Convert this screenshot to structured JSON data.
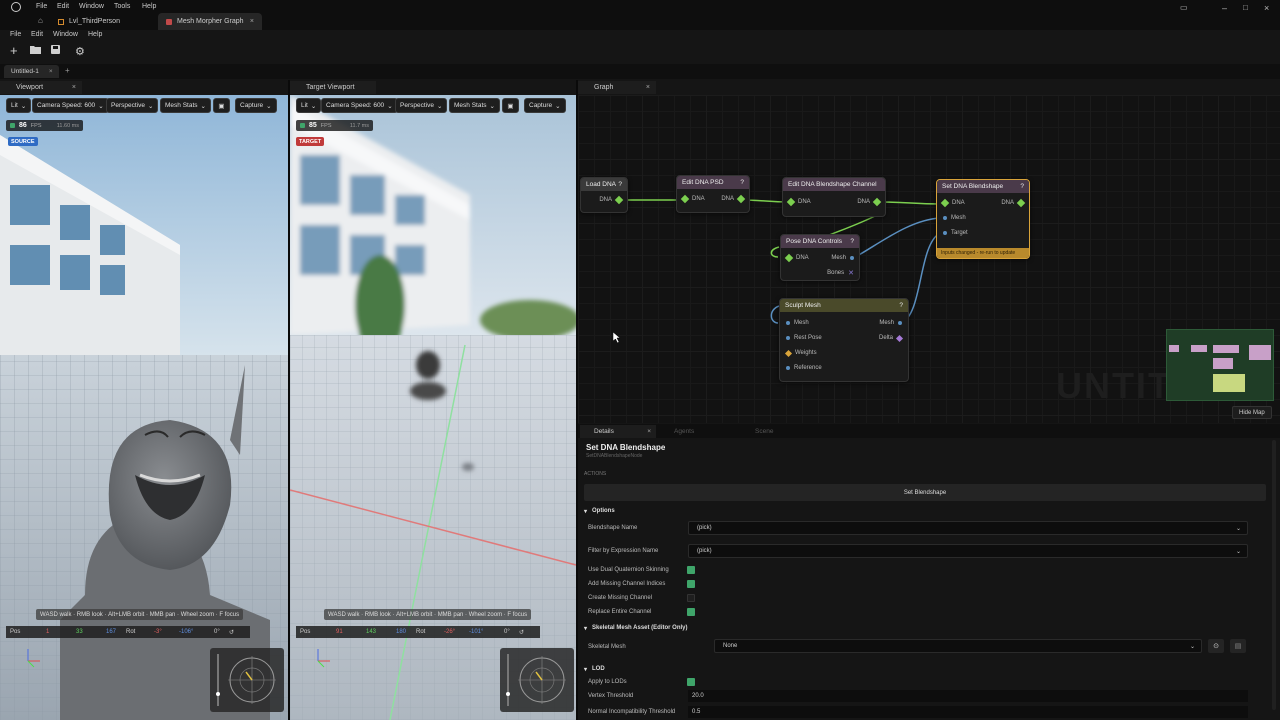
{
  "titlebar": {
    "menus": [
      "File",
      "Edit",
      "Window",
      "Tools",
      "Help"
    ],
    "tabs": [
      "Lvl_ThirdPerson",
      "Mesh Morpher Graph"
    ]
  },
  "menubar": {
    "items": [
      "File",
      "Edit",
      "Window",
      "Help"
    ]
  },
  "toolbar": {
    "icons": [
      "add-icon",
      "open-folder-icon",
      "save-icon",
      "settings-gear-icon"
    ]
  },
  "workspace_tab": {
    "label": "Untitled-1",
    "close": "×",
    "add": "+"
  },
  "viewports": [
    {
      "tab": "Viewport",
      "buttons": {
        "lit": "Lit",
        "camera_speed": "Camera Speed: 600",
        "perspective": "Perspective",
        "mesh_stats": "Mesh Stats",
        "capture": "Capture"
      },
      "fps_value": "86",
      "fps_unit": "FPS",
      "ms": "11.60 ms",
      "badge": "SOURCE",
      "hints": [
        "WASD walk",
        "RMB look",
        "Alt+LMB orbit",
        "MMB pan",
        "Wheel zoom",
        "F focus"
      ],
      "pos": {
        "label": "Pos",
        "x": "1",
        "y": "33",
        "z": "167",
        "rot_label": "Rot",
        "rx": "-3°",
        "ry": "-106°",
        "rz": "0°"
      }
    },
    {
      "tab": "Target Viewport",
      "buttons": {
        "lit": "Lit",
        "camera_speed": "Camera Speed: 600",
        "perspective": "Perspective",
        "mesh_stats": "Mesh Stats",
        "capture": "Capture"
      },
      "fps_value": "85",
      "fps_unit": "FPS",
      "ms": "11.7 ms",
      "badge": "TARGET",
      "hints": [
        "WASD walk",
        "RMB look",
        "Alt+LMB orbit",
        "MMB pan",
        "Wheel zoom",
        "F focus"
      ],
      "pos": {
        "label": "Pos",
        "x": "91",
        "y": "143",
        "z": "180",
        "rot_label": "Rot",
        "rx": "-26°",
        "ry": "-101°",
        "rz": "0°"
      }
    }
  ],
  "graph": {
    "tab": "Graph",
    "watermark": "UNTIT",
    "hide_map": "Hide Map",
    "nodes": {
      "load_dna": {
        "title": "Load DNA",
        "out": "DNA"
      },
      "edit_dna_psd": {
        "title": "Edit DNA PSD",
        "in": "DNA",
        "out": "DNA"
      },
      "edit_blendshape": {
        "title": "Edit DNA Blendshape Channel",
        "in": "DNA",
        "out": "DNA"
      },
      "set_blendshape": {
        "title": "Set DNA Blendshape",
        "in_dna": "DNA",
        "out_dna": "DNA",
        "mesh": "Mesh",
        "target": "Target",
        "status": "Inputs changed - re-run to update"
      },
      "pose_controls": {
        "title": "Pose DNA Controls",
        "in": "DNA",
        "mesh": "Mesh",
        "bones": "Bones"
      },
      "sculpt_mesh": {
        "title": "Sculpt Mesh",
        "mesh_in": "Mesh",
        "mesh_out": "Mesh",
        "rest_pose": "Rest Pose",
        "delta": "Delta",
        "weights": "Weights",
        "reference": "Reference"
      }
    }
  },
  "details": {
    "tabs": [
      "Details",
      "Agents",
      "Scene"
    ],
    "title": "Set DNA Blendshape",
    "subtitle": "SetDNABlendshapeNode",
    "actions_label": "ACTIONS",
    "action_button": "Set Blendshape",
    "sections": {
      "options": "Options",
      "skeletal": "Skeletal Mesh Asset (Editor Only)",
      "lod": "LOD"
    },
    "props": {
      "blendshape_name": {
        "label": "Blendshape Name",
        "value": "(pick)"
      },
      "filter_expression": {
        "label": "Filter by Expression Name",
        "value": "(pick)"
      },
      "dual_quat": {
        "label": "Use Dual Quaternion Skinning",
        "checked": true
      },
      "add_missing": {
        "label": "Add Missing Channel Indices",
        "checked": true
      },
      "create_missing": {
        "label": "Create Missing Channel",
        "checked": false
      },
      "replace_entire": {
        "label": "Replace Entire Channel",
        "checked": true
      },
      "skeletal_mesh": {
        "label": "Skeletal Mesh",
        "value": "None"
      },
      "apply_lods": {
        "label": "Apply to LODs",
        "checked": true
      },
      "vertex_threshold": {
        "label": "Vertex Threshold",
        "value": "20.0"
      },
      "normal_threshold": {
        "label": "Normal Incompatibility Threshold",
        "value": "0.5"
      }
    }
  },
  "colors": {
    "accent_green": "#3fa56a",
    "wire_green": "#7ccf4f",
    "wire_blue": "#5a8fc0",
    "node_selected": "#d9a43a",
    "source_badge": "#2f6bc4",
    "target_badge": "#c03a3a"
  }
}
